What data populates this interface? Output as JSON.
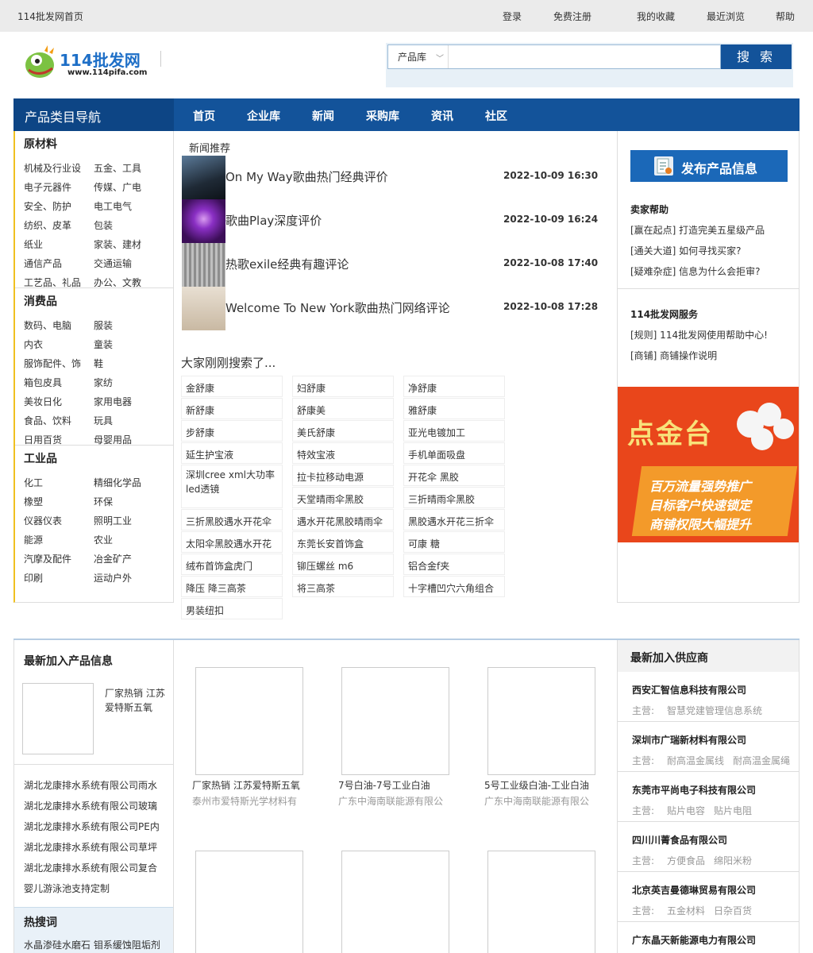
{
  "topbar": {
    "home": "114批发网首页",
    "links": [
      "登录",
      "免费注册",
      "我的收藏",
      "最近浏览",
      "帮助"
    ]
  },
  "logo": {
    "name": "114批发网",
    "url": "www.114pifa.com"
  },
  "search": {
    "category": "产品库",
    "value": "",
    "button": "搜 索"
  },
  "nav": {
    "category_title": "产品类目导航",
    "items": [
      "首页",
      "企业库",
      "新闻",
      "采购库",
      "资讯",
      "社区"
    ]
  },
  "categories": [
    {
      "title": "原材料",
      "items": [
        "机械及行业设",
        "五金、工具",
        "电子元器件",
        "传媒、广电",
        "安全、防护",
        "电工电气",
        "纺织、皮革",
        "包装",
        "纸业",
        "家装、建材",
        "通信产品",
        "交通运输",
        "工艺品、礼品",
        "办公、文教"
      ]
    },
    {
      "title": "消费品",
      "items": [
        "数码、电脑",
        "服装",
        "内衣",
        "童装",
        "服饰配件、饰",
        "鞋",
        "箱包皮具",
        "家纺",
        "美妆日化",
        "家用电器",
        "食品、饮料",
        "玩具",
        "日用百货",
        "母婴用品"
      ]
    },
    {
      "title": "工业品",
      "items": [
        "化工",
        "精细化学品",
        "橡塑",
        "环保",
        "仪器仪表",
        "照明工业",
        "能源",
        "农业",
        "汽摩及配件",
        "冶金矿产",
        "印刷",
        "运动户外"
      ]
    }
  ],
  "news": {
    "title": "新闻推荐",
    "items": [
      {
        "title": "On My Way歌曲热门经典评价",
        "date": "2022-10-09 16:30",
        "color": "#2d3d4e"
      },
      {
        "title": "歌曲Play深度评价",
        "date": "2022-10-09 16:24",
        "color": "#7a2ca8"
      },
      {
        "title": "热歌exile经典有趣评论",
        "date": "2022-10-08 17:40",
        "color": "#9a9a9a"
      },
      {
        "title": "Welcome To New York歌曲热门网络评论",
        "date": "2022-10-08 17:28",
        "color": "#d8cdbd"
      }
    ]
  },
  "searched": {
    "title": "大家刚刚搜索了...",
    "tags": [
      "金舒康",
      "妇舒康",
      "净舒康",
      "新舒康",
      "舒康美",
      "雅舒康",
      "步舒康",
      "美氏舒康",
      "亚光电镀加工",
      "延生护宝液",
      "特效宝液",
      "手机单面吸盘",
      "深圳cree xml大功率led透镜",
      "拉卡拉移动电源",
      "开花伞 黑胶",
      "天堂晴雨伞黑胶",
      "三折晴雨伞黑胶",
      "三折黑胶遇水开花伞",
      "遇水开花黑胶晴雨伞",
      "黑胶遇水开花三折伞",
      "太阳伞黑胶遇水开花",
      "东莞长安首饰盒",
      "可康 糖",
      "绒布首饰盒虎门",
      "铆压螺丝 m6",
      "铝合金f夹",
      "降压 降三高茶",
      "将三高茶",
      "十字槽凹穴六角组合",
      "男装纽扣"
    ]
  },
  "right": {
    "publish_button": "发布产品信息",
    "buyer_help": {
      "title": "卖家帮助",
      "items": [
        "[赢在起点] 打造完美五星级产品",
        "[通关大道] 如何寻找买家?",
        "[疑难杂症] 信息为什么会拒审?"
      ]
    },
    "service": {
      "title": "114批发网服务",
      "items": [
        "[规则] 114批发网使用帮助中心!",
        "[商铺] 商铺操作说明"
      ]
    },
    "banner": {
      "headline": "点金台",
      "lines": [
        "百万流量强势推广",
        "目标客户快速锁定",
        "商铺权限大幅提升"
      ]
    }
  },
  "newprod": {
    "title": "最新加入产品信息",
    "featured_desc": "厂家热销 江苏爱特斯五氧",
    "list": [
      "湖北龙康排水系统有限公司雨水",
      "湖北龙康排水系统有限公司玻璃",
      "湖北龙康排水系统有限公司PE内",
      "湖北龙康排水系统有限公司草坪",
      "湖北龙康排水系统有限公司复合",
      "婴儿游泳池支持定制"
    ]
  },
  "hot": {
    "title": "热搜词",
    "keywords": "水晶渗硅水磨石 钼系缓蚀阻垢剂"
  },
  "products": [
    {
      "title": "厂家热销 江苏爱特斯五氧",
      "company": "泰州市爱特斯光学材料有"
    },
    {
      "title": "7号白油-7号工业白油",
      "company": "广东中海南联能源有限公"
    },
    {
      "title": "5号工业级白油-工业白油",
      "company": "广东中海南联能源有限公"
    },
    {
      "title": "",
      "company": ""
    },
    {
      "title": "",
      "company": ""
    },
    {
      "title": "",
      "company": ""
    }
  ],
  "suppliers": {
    "title": "最新加入供应商",
    "main_label": "主营:",
    "items": [
      {
        "name": "西安汇智信息科技有限公司",
        "main": [
          "智慧党建管理信息系统"
        ]
      },
      {
        "name": "深圳市广瑞新材料有限公司",
        "main": [
          "耐高温金属线",
          "耐高温金属绳"
        ]
      },
      {
        "name": "东莞市平尚电子科技有限公司",
        "main": [
          "贴片电容",
          "贴片电阻"
        ]
      },
      {
        "name": "四川川菁食品有限公司",
        "main": [
          "方便食品",
          "绵阳米粉"
        ]
      },
      {
        "name": "北京英吉曼德琳贸易有限公司",
        "main": [
          "五金材料",
          "日杂百货"
        ]
      },
      {
        "name": "广东晶天新能源电力有限公司",
        "main": []
      }
    ]
  }
}
